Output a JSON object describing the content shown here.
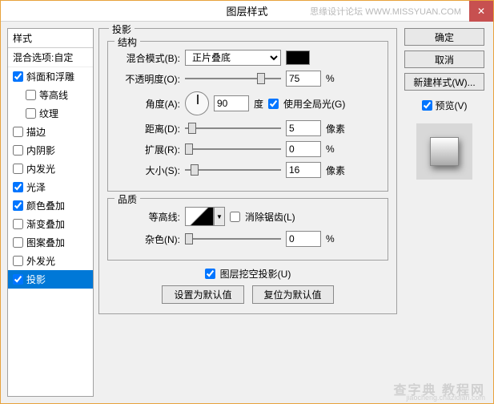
{
  "window": {
    "title": "图层样式",
    "watermark": "思缘设计论坛  WWW.MISSYUAN.COM",
    "close": "✕"
  },
  "sidebar": {
    "header": "样式",
    "blend_options": "混合选项:自定",
    "items": [
      {
        "label": "斜面和浮雕",
        "checked": true,
        "indent": false
      },
      {
        "label": "等高线",
        "checked": false,
        "indent": true
      },
      {
        "label": "纹理",
        "checked": false,
        "indent": true
      },
      {
        "label": "描边",
        "checked": false,
        "indent": false
      },
      {
        "label": "内阴影",
        "checked": false,
        "indent": false
      },
      {
        "label": "内发光",
        "checked": false,
        "indent": false
      },
      {
        "label": "光泽",
        "checked": true,
        "indent": false
      },
      {
        "label": "颜色叠加",
        "checked": true,
        "indent": false
      },
      {
        "label": "渐变叠加",
        "checked": false,
        "indent": false
      },
      {
        "label": "图案叠加",
        "checked": false,
        "indent": false
      },
      {
        "label": "外发光",
        "checked": false,
        "indent": false
      },
      {
        "label": "投影",
        "checked": true,
        "indent": false,
        "selected": true
      }
    ]
  },
  "main": {
    "section_title": "投影",
    "structure": {
      "title": "结构",
      "blend_mode_label": "混合模式(B):",
      "blend_mode_value": "正片叠底",
      "opacity_label": "不透明度(O):",
      "opacity_value": "75",
      "opacity_unit": "%",
      "angle_label": "角度(A):",
      "angle_value": "90",
      "angle_unit": "度",
      "global_light_label": "使用全局光(G)",
      "global_light_checked": true,
      "distance_label": "距离(D):",
      "distance_value": "5",
      "distance_unit": "像素",
      "spread_label": "扩展(R):",
      "spread_value": "0",
      "spread_unit": "%",
      "size_label": "大小(S):",
      "size_value": "16",
      "size_unit": "像素"
    },
    "quality": {
      "title": "品质",
      "contour_label": "等高线:",
      "antialias_label": "消除锯齿(L)",
      "antialias_checked": false,
      "noise_label": "杂色(N):",
      "noise_value": "0",
      "noise_unit": "%"
    },
    "knockout_label": "图层挖空投影(U)",
    "knockout_checked": true,
    "btn_default": "设置为默认值",
    "btn_reset": "复位为默认值"
  },
  "right": {
    "ok": "确定",
    "cancel": "取消",
    "new_style": "新建样式(W)...",
    "preview_label": "预览(V)",
    "preview_checked": true
  },
  "bottom_watermark": "查字典 教程网",
  "bottom_watermark_sub": "jiaocheng.chazidian.com"
}
